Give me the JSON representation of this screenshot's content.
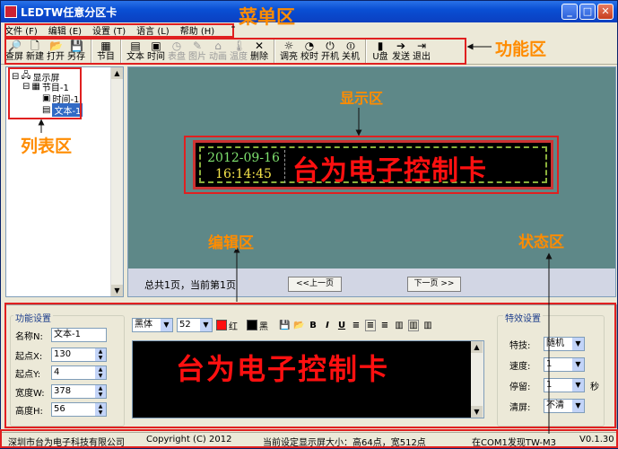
{
  "window": {
    "title": "LEDTW任意分区卡"
  },
  "menu": [
    {
      "label": "文件 (F)"
    },
    {
      "label": "编辑 (E)"
    },
    {
      "label": "设置 (T)"
    },
    {
      "label": "语言 (L)"
    },
    {
      "label": "帮助 (H)"
    }
  ],
  "toolbar": [
    {
      "label": "查屏",
      "icon": "magnifier-icon",
      "glyph": "🔎"
    },
    {
      "label": "新建",
      "icon": "new-file-icon",
      "glyph": "🗋"
    },
    {
      "label": "打开",
      "icon": "open-folder-icon",
      "glyph": "📂"
    },
    {
      "label": "另存",
      "icon": "save-icon",
      "glyph": "💾"
    },
    {
      "label": "节目",
      "icon": "program-icon",
      "glyph": "▦"
    },
    {
      "label": "文本",
      "icon": "text-icon",
      "glyph": "▤"
    },
    {
      "label": "时间",
      "icon": "time-icon",
      "glyph": "▣"
    },
    {
      "label": "表盘",
      "icon": "clock-dial-icon",
      "glyph": "◷",
      "disabled": true
    },
    {
      "label": "图片",
      "icon": "picture-icon",
      "glyph": "✎",
      "disabled": true
    },
    {
      "label": "动画",
      "icon": "animation-icon",
      "glyph": "⌂",
      "disabled": true
    },
    {
      "label": "温度",
      "icon": "temperature-icon",
      "glyph": "🌡",
      "disabled": true
    },
    {
      "label": "删除",
      "icon": "delete-icon",
      "glyph": "✕"
    },
    {
      "label": "调亮",
      "icon": "brightness-icon",
      "glyph": "☼"
    },
    {
      "label": "校时",
      "icon": "sync-time-icon",
      "glyph": "◔"
    },
    {
      "label": "开机",
      "icon": "power-on-icon",
      "glyph": "⏻"
    },
    {
      "label": "关机",
      "icon": "power-off-icon",
      "glyph": "⏼"
    },
    {
      "label": "U盘",
      "icon": "usb-icon",
      "glyph": "▮"
    },
    {
      "label": "发送",
      "icon": "send-icon",
      "glyph": "➔"
    },
    {
      "label": "退出",
      "icon": "exit-icon",
      "glyph": "⇥"
    }
  ],
  "tree": {
    "root": "显示屏",
    "program": "节目-1",
    "items": [
      "时间-1",
      "文本-1"
    ]
  },
  "preview": {
    "date": "2012-09-16",
    "time": "16:14:45",
    "text": "台为电子控制卡"
  },
  "paging": {
    "summary": "总共1页，当前第1页",
    "prev": "<<上一页",
    "next": "下一页 >>"
  },
  "function_settings": {
    "title": "功能设置",
    "name_label": "名称N:",
    "name_value": "文本-1",
    "x_label": "起点X:",
    "x_value": "130",
    "y_label": "起点Y:",
    "y_value": "4",
    "w_label": "宽度W:",
    "w_value": "378",
    "h_label": "高度H:",
    "h_value": "56"
  },
  "editor": {
    "font": "黑体",
    "size": "52",
    "fg_color_label": "红",
    "bg_color_label": "黑",
    "bold": "B",
    "italic": "I",
    "underline": "U",
    "text": "台为电子控制卡",
    "colors": {
      "red": "#ff1010",
      "black": "#000000"
    }
  },
  "effects": {
    "title": "特效设置",
    "effect_label": "特技:",
    "effect_value": "随机",
    "speed_label": "速度:",
    "speed_value": "1",
    "stay_label": "停留:",
    "stay_value": "1",
    "stay_unit": "秒",
    "clear_label": "清屏:",
    "clear_value": "不清"
  },
  "status": {
    "company": "深圳市台为电子科技有限公司",
    "copyright": "Copyright  (C) 2012",
    "size_info": "当前设定显示屏大小：高64点，宽512点",
    "port_info": "在COM1发现TW-M3",
    "version": "V0.1.30"
  },
  "annotations": {
    "menu_area": "菜单区",
    "function_area": "功能区",
    "display_area": "显示区",
    "list_area": "列表区",
    "edit_area": "编辑区",
    "status_area": "状态区",
    "color": "#ff8c00"
  }
}
